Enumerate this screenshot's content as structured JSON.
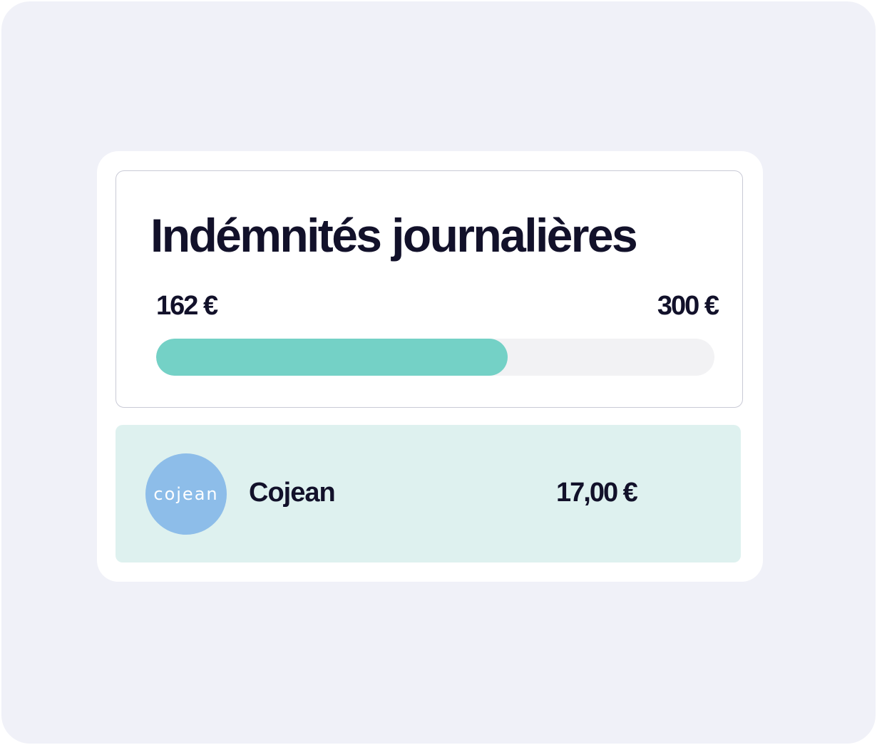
{
  "card": {
    "title": "Indémnités journalières"
  },
  "progress": {
    "current_label": "162 €",
    "max_label": "300 €",
    "fill_fraction": 0.63,
    "fill_color": "#74d1c6",
    "track_color": "#f2f2f4"
  },
  "transaction": {
    "merchant_logo_text": "cojean",
    "merchant_name": "Cojean",
    "amount": "17,00 €",
    "logo_color": "#8dbde9",
    "row_color": "#def1ef"
  },
  "colors": {
    "background": "#f0f1f8",
    "text": "#12112a"
  }
}
